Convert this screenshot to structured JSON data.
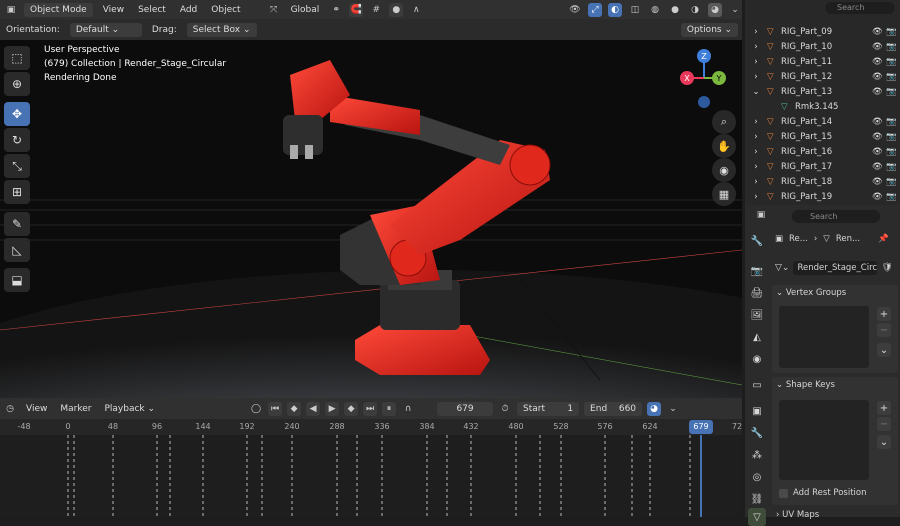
{
  "header": {
    "mode": "Object Mode",
    "menus": [
      "View",
      "Select",
      "Add",
      "Object"
    ],
    "transform_orientation": "Global"
  },
  "tool_header": {
    "orientation_label": "Orientation:",
    "orientation_value": "Default",
    "drag_label": "Drag:",
    "drag_value": "Select Box",
    "options": "Options"
  },
  "viewport": {
    "perspective": "User Perspective",
    "collection": "(679) Collection | Render_Stage_Circular",
    "status": "Rendering Done",
    "gizmo": {
      "x": "X",
      "y": "Y",
      "z": "Z"
    }
  },
  "timeline": {
    "menus": [
      "View",
      "Marker",
      "Playback"
    ],
    "current_frame": "679",
    "start_label": "Start",
    "start": "1",
    "end_label": "End",
    "end": "660",
    "ruler": [
      "-48",
      "0",
      "48",
      "96",
      "144",
      "192",
      "240",
      "288",
      "336",
      "384",
      "432",
      "480",
      "528",
      "576",
      "624",
      "679",
      "72"
    ],
    "playhead": "679"
  },
  "outliner": {
    "search_placeholder": "Search",
    "items": [
      {
        "label": "RIG_Part_09",
        "type": "object"
      },
      {
        "label": "RIG_Part_10",
        "type": "object"
      },
      {
        "label": "RIG_Part_11",
        "type": "object"
      },
      {
        "label": "RIG_Part_12",
        "type": "object"
      },
      {
        "label": "RIG_Part_13",
        "type": "object"
      },
      {
        "label": "Rmk3.145",
        "type": "mesh"
      },
      {
        "label": "RIG_Part_14",
        "type": "object"
      },
      {
        "label": "RIG_Part_15",
        "type": "object"
      },
      {
        "label": "RIG_Part_16",
        "type": "object"
      },
      {
        "label": "RIG_Part_17",
        "type": "object"
      },
      {
        "label": "RIG_Part_18",
        "type": "object"
      },
      {
        "label": "RIG_Part_19",
        "type": "object"
      }
    ]
  },
  "properties": {
    "search_placeholder": "Search",
    "breadcrumb_1": "Re...",
    "breadcrumb_2": "Ren...",
    "data_name": "Render_Stage_Circ...",
    "vertex_groups": "Vertex Groups",
    "shape_keys": "Shape Keys",
    "add_rest_position": "Add Rest Position",
    "next_panel": "UV Maps"
  },
  "colors": {
    "accent": "#4772b3",
    "robot": "#e8241a",
    "x_axis": "#e8395a",
    "y_axis": "#7ab83e",
    "z_axis": "#3f7fdc"
  }
}
